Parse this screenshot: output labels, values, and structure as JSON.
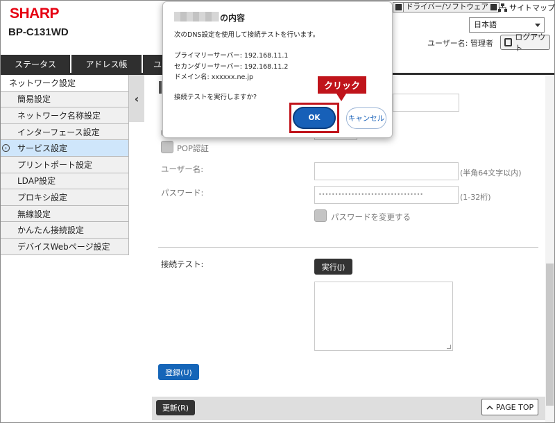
{
  "header": {
    "brand": "SHARP",
    "model": "BP-C131WD",
    "links": [
      {
        "label": "ドライバー/ソフトウェア"
      },
      {
        "label": "サイトマップ"
      }
    ],
    "language": "日本語",
    "user_label": "ユーザー名: 管理者",
    "logout_label": "ログアウト"
  },
  "tabs": [
    {
      "label": "ステータス"
    },
    {
      "label": "アドレス帳"
    },
    {
      "label": "ユ"
    }
  ],
  "sidebar": {
    "items": [
      {
        "label": "ネットワーク設定"
      },
      {
        "label": "簡易設定"
      },
      {
        "label": "ネットワーク名称設定"
      },
      {
        "label": "インターフェース設定"
      },
      {
        "label": "サービス設定"
      },
      {
        "label": "プリントポート設定"
      },
      {
        "label": "LDAP設定"
      },
      {
        "label": "プロキシ設定"
      },
      {
        "label": "無線設定"
      },
      {
        "label": "かんたん接続設定"
      },
      {
        "label": "デバイスWebページ設定"
      }
    ]
  },
  "form": {
    "pop_auth_label": "POP認証",
    "username_label": "ユーザー名:",
    "username_hint": "(半角64文字以内)",
    "password_label": "パスワード:",
    "password_mask": "••••••••••••••••••••••••••••••••",
    "password_hint": "(1-32桁)",
    "change_password_label": "パスワードを変更する",
    "connection_test_label": "接続テスト:",
    "execute_button": "実行(J)",
    "register_button": "登録(U)",
    "refresh_button": "更新(R)",
    "pagetop_label": "PAGE TOP"
  },
  "dialog": {
    "title": "の内容",
    "message": "次のDNS設定を使用して接続テストを行います。",
    "primary_server": "プライマリーサーバー: 192.168.11.1",
    "secondary_server": "セカンダリーサーバー: 192.168.11.2",
    "domain_name": "ドメイン名: xxxxxx.ne.jp",
    "confirm": "接続テストを実行しますか?",
    "ok_label": "OK",
    "cancel_label": "キャンセル"
  },
  "annotation": {
    "callout": "クリック"
  },
  "colors": {
    "brand": "#e60012",
    "accent_blue": "#1565b8",
    "highlight_red": "#c0141b",
    "active_sidebar": "#cfe6fb"
  }
}
